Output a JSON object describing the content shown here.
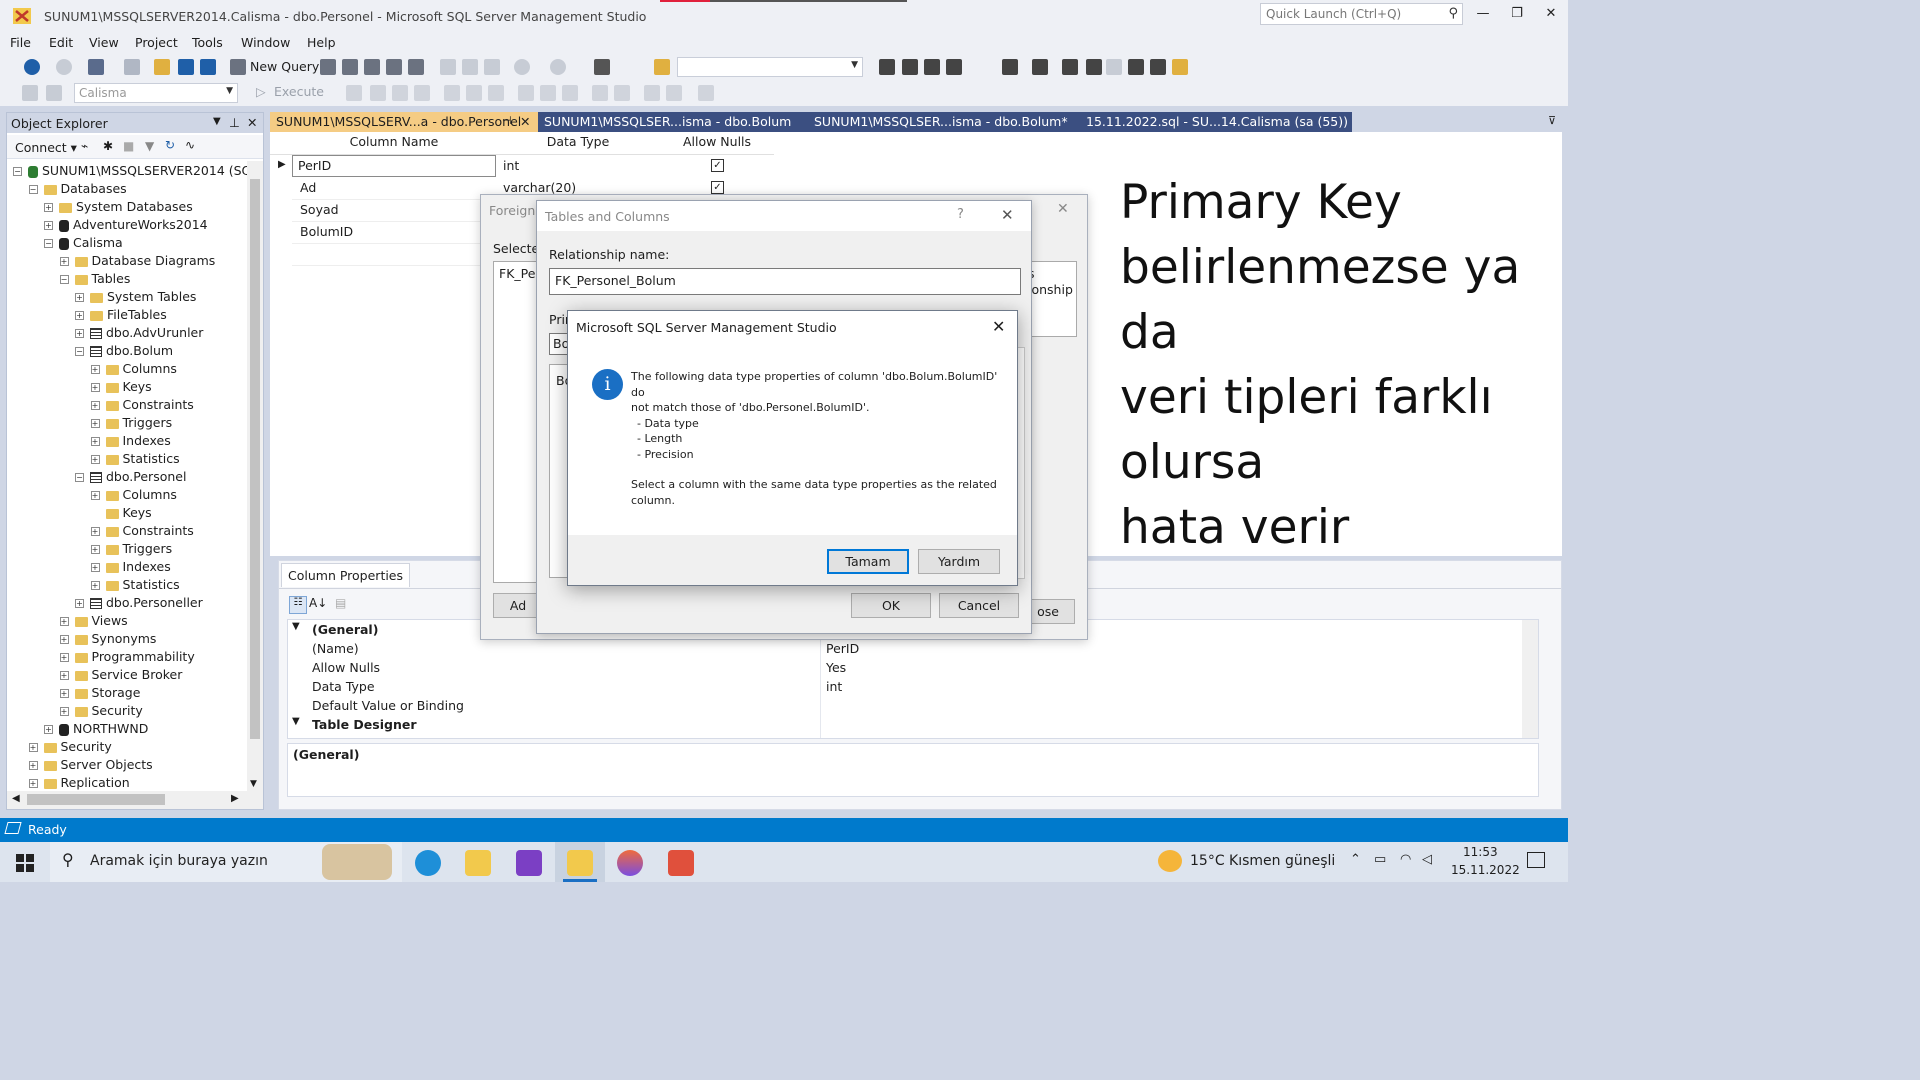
{
  "window": {
    "title": "SUNUM1\\MSSQLSERVER2014.Calisma - dbo.Personel - Microsoft SQL Server Management Studio",
    "quick_launch_placeholder": "Quick Launch (Ctrl+Q)",
    "minimize": "—",
    "restore": "❐",
    "close": "✕"
  },
  "menu": [
    "File",
    "Edit",
    "View",
    "Project",
    "Tools",
    "Window",
    "Help"
  ],
  "toolbar": {
    "new_query": "New Query",
    "database_combo": "Calisma",
    "execute": "Execute"
  },
  "object_explorer": {
    "title": "Object Explorer",
    "connect": "Connect",
    "nodes": [
      {
        "label": "SUNUM1\\MSSQLSERVER2014 (SQL Se",
        "level": 0,
        "state": "−",
        "icon": "server"
      },
      {
        "label": "Databases",
        "level": 1,
        "state": "−",
        "icon": "folder"
      },
      {
        "label": "System Databases",
        "level": 2,
        "state": "+",
        "icon": "folder"
      },
      {
        "label": "AdventureWorks2014",
        "level": 2,
        "state": "+",
        "icon": "db"
      },
      {
        "label": "Calisma",
        "level": 2,
        "state": "−",
        "icon": "db"
      },
      {
        "label": "Database Diagrams",
        "level": 3,
        "state": "+",
        "icon": "folder"
      },
      {
        "label": "Tables",
        "level": 3,
        "state": "−",
        "icon": "folder"
      },
      {
        "label": "System Tables",
        "level": 4,
        "state": "+",
        "icon": "folder"
      },
      {
        "label": "FileTables",
        "level": 4,
        "state": "+",
        "icon": "folder"
      },
      {
        "label": "dbo.AdvUrunler",
        "level": 4,
        "state": "+",
        "icon": "table"
      },
      {
        "label": "dbo.Bolum",
        "level": 4,
        "state": "−",
        "icon": "table"
      },
      {
        "label": "Columns",
        "level": 5,
        "state": "+",
        "icon": "folder"
      },
      {
        "label": "Keys",
        "level": 5,
        "state": "+",
        "icon": "folder"
      },
      {
        "label": "Constraints",
        "level": 5,
        "state": "+",
        "icon": "folder"
      },
      {
        "label": "Triggers",
        "level": 5,
        "state": "+",
        "icon": "folder"
      },
      {
        "label": "Indexes",
        "level": 5,
        "state": "+",
        "icon": "folder"
      },
      {
        "label": "Statistics",
        "level": 5,
        "state": "+",
        "icon": "folder"
      },
      {
        "label": "dbo.Personel",
        "level": 4,
        "state": "−",
        "icon": "table"
      },
      {
        "label": "Columns",
        "level": 5,
        "state": "+",
        "icon": "folder"
      },
      {
        "label": "Keys",
        "level": 5,
        "state": "",
        "icon": "folder"
      },
      {
        "label": "Constraints",
        "level": 5,
        "state": "+",
        "icon": "folder"
      },
      {
        "label": "Triggers",
        "level": 5,
        "state": "+",
        "icon": "folder"
      },
      {
        "label": "Indexes",
        "level": 5,
        "state": "+",
        "icon": "folder"
      },
      {
        "label": "Statistics",
        "level": 5,
        "state": "+",
        "icon": "folder"
      },
      {
        "label": "dbo.Personeller",
        "level": 4,
        "state": "+",
        "icon": "table"
      },
      {
        "label": "Views",
        "level": 3,
        "state": "+",
        "icon": "folder"
      },
      {
        "label": "Synonyms",
        "level": 3,
        "state": "+",
        "icon": "folder"
      },
      {
        "label": "Programmability",
        "level": 3,
        "state": "+",
        "icon": "folder"
      },
      {
        "label": "Service Broker",
        "level": 3,
        "state": "+",
        "icon": "folder"
      },
      {
        "label": "Storage",
        "level": 3,
        "state": "+",
        "icon": "folder"
      },
      {
        "label": "Security",
        "level": 3,
        "state": "+",
        "icon": "folder"
      },
      {
        "label": "NORTHWND",
        "level": 2,
        "state": "+",
        "icon": "db"
      },
      {
        "label": "Security",
        "level": 1,
        "state": "+",
        "icon": "folder"
      },
      {
        "label": "Server Objects",
        "level": 1,
        "state": "+",
        "icon": "folder"
      },
      {
        "label": "Replication",
        "level": 1,
        "state": "+",
        "icon": "folder"
      }
    ]
  },
  "tabs": [
    {
      "label": "SUNUM1\\MSSQLSERV...a - dbo.Personel",
      "active": true
    },
    {
      "label": "SUNUM1\\MSSQLSER...isma - dbo.Bolum",
      "active": false
    },
    {
      "label": "SUNUM1\\MSSQLSER...isma - dbo.Bolum*",
      "active": false
    },
    {
      "label": "15.11.2022.sql - SU...14.Calisma (sa (55))",
      "active": false
    }
  ],
  "designer": {
    "headers": [
      "Column Name",
      "Data Type",
      "Allow Nulls"
    ],
    "rows": [
      {
        "name": "PerID",
        "type": "int",
        "nulls": true
      },
      {
        "name": "Ad",
        "type": "varchar(20)",
        "nulls": true
      },
      {
        "name": "Soyad",
        "type": "",
        "nulls": false
      },
      {
        "name": "BolumID",
        "type": "",
        "nulls": false
      }
    ]
  },
  "overlay_text": [
    "Primary Key",
    "belirlenmezse ya",
    "da",
    "veri tipleri farklı",
    "olursa",
    "hata verir"
  ],
  "column_properties": {
    "tab": "Column Properties",
    "section_general": "(General)",
    "rows": [
      {
        "key": "(Name)",
        "value": "PerID"
      },
      {
        "key": "Allow Nulls",
        "value": "Yes"
      },
      {
        "key": "Data Type",
        "value": "int"
      },
      {
        "key": "Default Value or Binding",
        "value": ""
      }
    ],
    "section_designer": "Table Designer",
    "description": "(General)"
  },
  "fk_dialog": {
    "title": "Foreign K",
    "selected_label": "Selected",
    "selected_item": "FK_Pers",
    "right_frag_1": "s",
    "right_frag_2": "ionship",
    "add_button": "Ad",
    "close_button": "ose"
  },
  "tc_dialog": {
    "title": "Tables and Columns",
    "help": "?",
    "relationship_label": "Relationship name:",
    "relationship_value": "FK_Personel_Bolum",
    "primary_label": "Prin",
    "primary_value": "Bo",
    "list_item": "Bo",
    "ok": "OK",
    "cancel": "Cancel"
  },
  "message_box": {
    "title": "Microsoft SQL Server Management Studio",
    "line1": "The following data type properties of column 'dbo.Bolum.BolumID' do",
    "line2": "not match those of 'dbo.Personel.BolumID'.",
    "item1": "- Data type",
    "item2": "- Length",
    "item3": "- Precision",
    "line3": "Select a column with the same data type properties as the related",
    "line4": "column.",
    "ok": "Tamam",
    "help": "Yardım"
  },
  "status": {
    "text": "Ready"
  },
  "taskbar": {
    "search_placeholder": "Aramak için buraya yazın",
    "weather": "15°C  Kısmen güneşli",
    "time": "11:53",
    "date": "15.11.2022"
  },
  "colors": {
    "accent": "#007acc",
    "tab_active": "#f5cc84",
    "tab_inactive": "#3b4f81"
  }
}
